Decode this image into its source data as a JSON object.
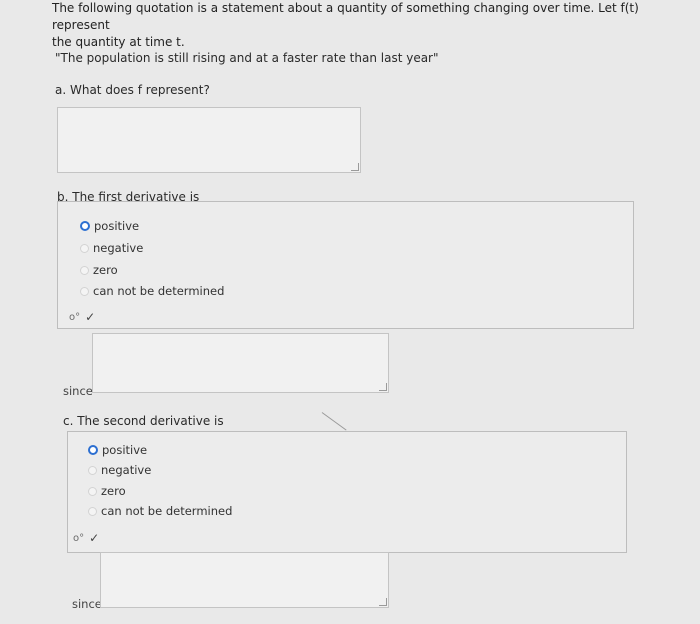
{
  "intro": {
    "line1": "The following quotation is a statement about a quantity of something changing over time. Let f(t) represent",
    "line2": "the quantity at time t."
  },
  "quote": "\"The population is still rising and at a faster rate than last year\"",
  "part_a": {
    "question": "a. What does f represent?",
    "answer_value": ""
  },
  "part_b": {
    "question": "b. The first derivative is",
    "options": [
      "positive",
      "negative",
      "zero",
      "can not be determined"
    ],
    "selected": "positive",
    "check_mark": "✓",
    "since_label": "since",
    "since_value": ""
  },
  "part_c": {
    "question": "c. The second derivative is",
    "options": [
      "positive",
      "negative",
      "zero",
      "can not be determined"
    ],
    "selected": "positive",
    "check_mark": "✓",
    "since_label": "since",
    "since_value": ""
  }
}
